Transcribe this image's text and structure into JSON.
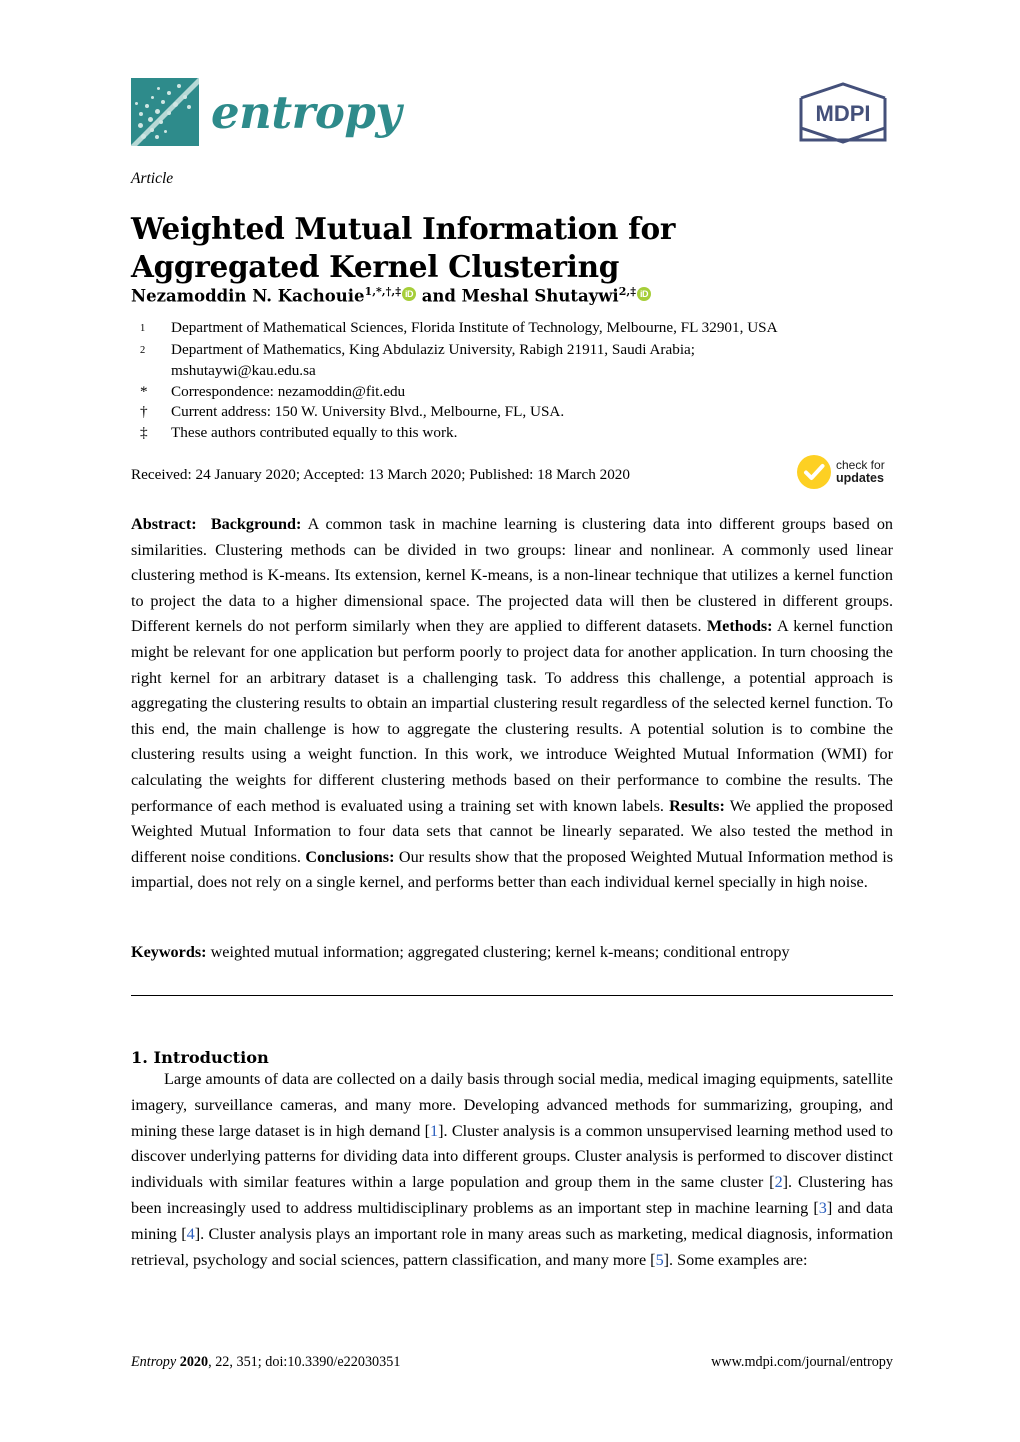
{
  "journal": {
    "logo_word": "entropy",
    "logo_mark_name": "entropy-logo-mark",
    "publisher_logo_text": "MDPI"
  },
  "article": {
    "type": "Article",
    "title": "Weighted Mutual Information for Aggregated Kernel Clustering",
    "authors_prefix": "Nezamoddin N. Kachouie",
    "authors_sup1": "1,*,†,‡",
    "authors_joiner": " and ",
    "authors_second": "Meshal Shutaywi",
    "authors_sup2": "2,‡",
    "orcid_label": "iD"
  },
  "affiliations": [
    {
      "marker": "1",
      "text": "Department of Mathematical Sciences, Florida Institute of Technology, Melbourne, FL 32901, USA"
    },
    {
      "marker": "2",
      "text": "Department of Mathematics, King Abdulaziz University, Rabigh 21911, Saudi Arabia;",
      "continuation": "mshutaywi@kau.edu.sa"
    },
    {
      "marker": "*",
      "text": "Correspondence: nezamoddin@fit.edu"
    },
    {
      "marker": "†",
      "text": "Current address: 150 W. University Blvd., Melbourne, FL, USA."
    },
    {
      "marker": "‡",
      "text": "These authors contributed equally to this work."
    }
  ],
  "dates_line": "Received: 24 January 2020; Accepted: 13 March 2020; Published: 18 March 2020",
  "check_updates": {
    "line1": "check for",
    "line2": "updates",
    "circle_color": "#fdd023",
    "icon_name": "check-mark-icon"
  },
  "abstract": {
    "label": "Abstract:",
    "background_label": "Background:",
    "background_text": " A common task in machine learning is clustering data into different groups based on similarities. Clustering methods can be divided in two groups: linear and nonlinear. A commonly used linear clustering method is K-means. Its extension, kernel K-means, is a non-linear technique that utilizes a kernel function to project the data to a higher dimensional space. The projected data will then be clustered in different groups. Different kernels do not perform similarly when they are applied to different datasets. ",
    "methods_label": "Methods:",
    "methods_text": " A kernel function might be relevant for one application but perform poorly to project data for another application. In turn choosing the right kernel for an arbitrary dataset is a challenging task. To address this challenge, a potential approach is aggregating the clustering results to obtain an impartial clustering result regardless of the selected kernel function. To this end, the main challenge is how to aggregate the clustering results. A potential solution is to combine the clustering results using a weight function. In this work, we introduce Weighted Mutual Information (WMI) for calculating the weights for different clustering methods based on their performance to combine the results. The performance of each method is evaluated using a training set with known labels. ",
    "results_label": "Results:",
    "results_text": " We applied the proposed Weighted Mutual Information to four data sets that cannot be linearly separated. We also tested the method in different noise conditions. ",
    "conclusions_label": "Conclusions:",
    "conclusions_text": " Our results show that the proposed Weighted Mutual Information method is impartial, does not rely on a single kernel, and performs better than each individual kernel specially in high noise."
  },
  "keywords": {
    "label": "Keywords:",
    "text": " weighted mutual information; aggregated clustering; kernel k-means; conditional entropy"
  },
  "introduction": {
    "heading": "1. Introduction",
    "p1_a": "Large amounts of data are collected on a daily basis through social media, medical imaging equipments, satellite imagery, surveillance cameras, and many more. Developing advanced methods for summarizing, grouping, and mining these large dataset is in high demand [",
    "c1": "1",
    "p1_b": "]. Cluster analysis is a common unsupervised learning method used to discover underlying patterns for dividing data into different groups. Cluster analysis is performed to discover distinct individuals with similar features within a large population and group them in the same cluster [",
    "c2": "2",
    "p1_c": "]. Clustering has been increasingly used to address multidisciplinary problems as an important step in machine learning [",
    "c3": "3",
    "p1_d": "] and data mining [",
    "c4": "4",
    "p1_e": "]. Cluster analysis plays an important role in many areas such as marketing, medical diagnosis, information retrieval, psychology and social sciences, pattern classification, and many more [",
    "c5": "5",
    "p1_f": "]. Some examples are:"
  },
  "footer": {
    "journal_italic": "Entropy",
    "year": "2020",
    "volume_page": ", 22, 351; doi:10.3390/e22030351",
    "url": "www.mdpi.com/journal/entropy"
  },
  "colors": {
    "brand_teal": "#2e8b8b",
    "mdpi_navy": "#44507a",
    "orcid_green": "#a6ce39",
    "citation_blue": "#2b5fbe"
  }
}
